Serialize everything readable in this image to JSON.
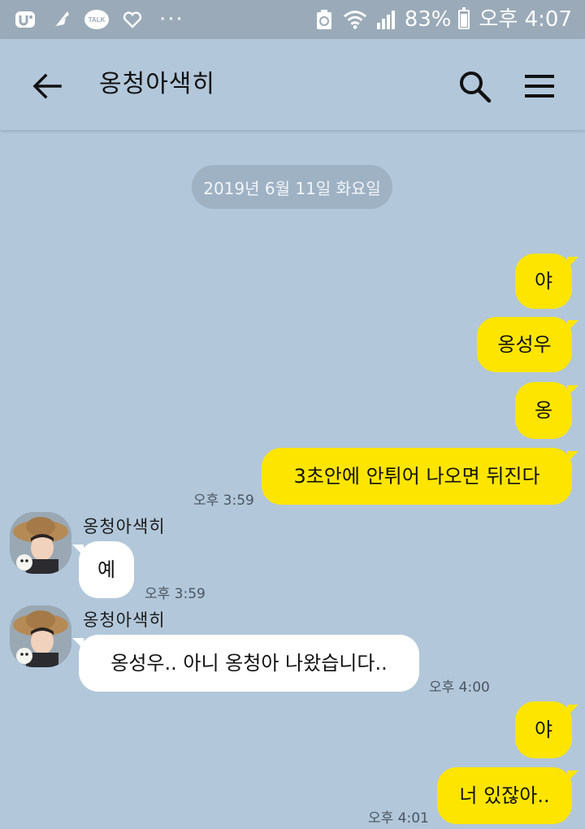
{
  "status_bar": {
    "talk_label": "TALK",
    "more_dots": "···",
    "battery_percent": "83%",
    "time": "오후 4:07"
  },
  "header": {
    "title": "옹청아색히"
  },
  "date_divider": "2019년 6월 11일 화요일",
  "messages": [
    {
      "side": "sent",
      "text": "야"
    },
    {
      "side": "sent",
      "text": "옹성우"
    },
    {
      "side": "sent",
      "text": "옹"
    },
    {
      "side": "sent",
      "text": "3초안에 안튀어 나오면 뒤진다",
      "time": "오후 3:59"
    },
    {
      "side": "recv",
      "sender": "옹청아색히",
      "text": "예",
      "time": "오후 3:59"
    },
    {
      "side": "recv",
      "sender": "옹청아색히",
      "text": "옹성우.. 아니 옹청아 나왔습니다..",
      "time": "오후 4:00"
    },
    {
      "side": "sent",
      "text": "야"
    },
    {
      "side": "sent",
      "text": "너 있잖아..",
      "time": "오후 4:01"
    }
  ],
  "colors": {
    "chat_background": "#b2c7da",
    "status_bar": "#9aaab8",
    "sent_bubble": "#fee500",
    "received_bubble": "#ffffff",
    "date_pill": "#9fb2c4"
  },
  "icons": {
    "back": "arrow-left-icon",
    "search": "search-icon",
    "menu": "hamburger-menu-icon"
  }
}
